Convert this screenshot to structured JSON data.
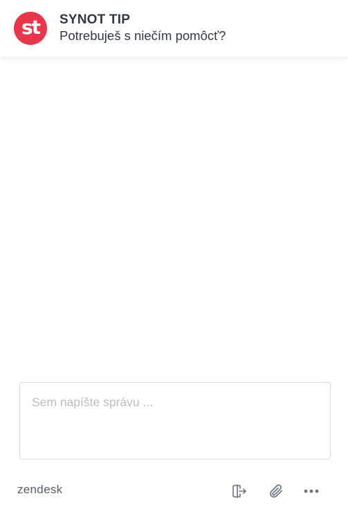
{
  "header": {
    "logo_text": "st",
    "logo_color": "#e8374a",
    "title": "SYNOT TIP",
    "subtitle": "Potrebuješ s niečím pomôcť?"
  },
  "composer": {
    "placeholder": "Sem napíšte správu ...",
    "value": ""
  },
  "footer": {
    "brand": "zendesk",
    "icons": [
      "exit-chat-icon",
      "attachment-icon",
      "more-options-icon"
    ]
  },
  "colors": {
    "text": "#2f3941",
    "placeholder": "#b9bec3",
    "border": "#d8dcde",
    "icon": "#68737d"
  }
}
